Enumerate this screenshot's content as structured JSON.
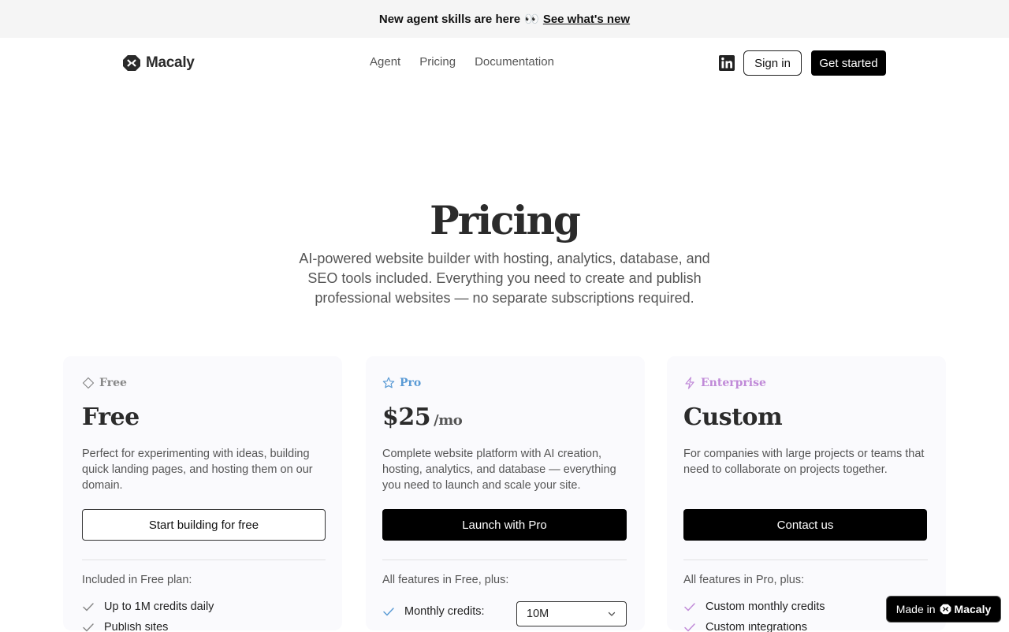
{
  "announcement": {
    "text": "New agent skills are here",
    "emoji": "👀",
    "link": "See what's new"
  },
  "nav": {
    "brand": "Macaly",
    "links": [
      "Agent",
      "Pricing",
      "Documentation"
    ],
    "signin": "Sign in",
    "get_started": "Get started"
  },
  "hero": {
    "title": "Pricing",
    "subtitle": "AI-powered website builder with hosting, analytics, database, and SEO tools included. Everything you need to create and publish professional websites — no separate subscriptions required."
  },
  "plans": [
    {
      "tag": "Free",
      "tag_color": "#888888",
      "icon": "tag-icon",
      "price": "Free",
      "per": "",
      "description": "Perfect for experimenting with ideas, building quick landing pages, and hosting them on our domain.",
      "cta": "Start building for free",
      "included": "Included in Free plan:",
      "features": [
        "Up to 1M credits daily",
        "Publish sites"
      ],
      "check_color": "#888888"
    },
    {
      "tag": "Pro",
      "tag_color": "#5b9bd5",
      "icon": "star-icon",
      "price": "$25",
      "per": "/mo",
      "description": "Complete website platform with AI creation, hosting, analytics, and database — everything you need to launch and scale your site.",
      "cta": "Launch with Pro",
      "included": "All features in Free, plus:",
      "features": [
        "Monthly credits:"
      ],
      "select_value": "10M",
      "check_color": "#5b9bd5"
    },
    {
      "tag": "Enterprise",
      "tag_color": "#c08ad8",
      "icon": "lightning-icon",
      "price": "Custom",
      "per": "",
      "description": "For companies with large projects or teams that need to collaborate on projects together.",
      "cta": "Contact us",
      "included": "All features in Pro, plus:",
      "features": [
        "Custom monthly credits",
        "Custom integrations"
      ],
      "check_color": "#c08ad8"
    }
  ],
  "badge": {
    "made_in": "Made in",
    "brand": "Macaly"
  }
}
